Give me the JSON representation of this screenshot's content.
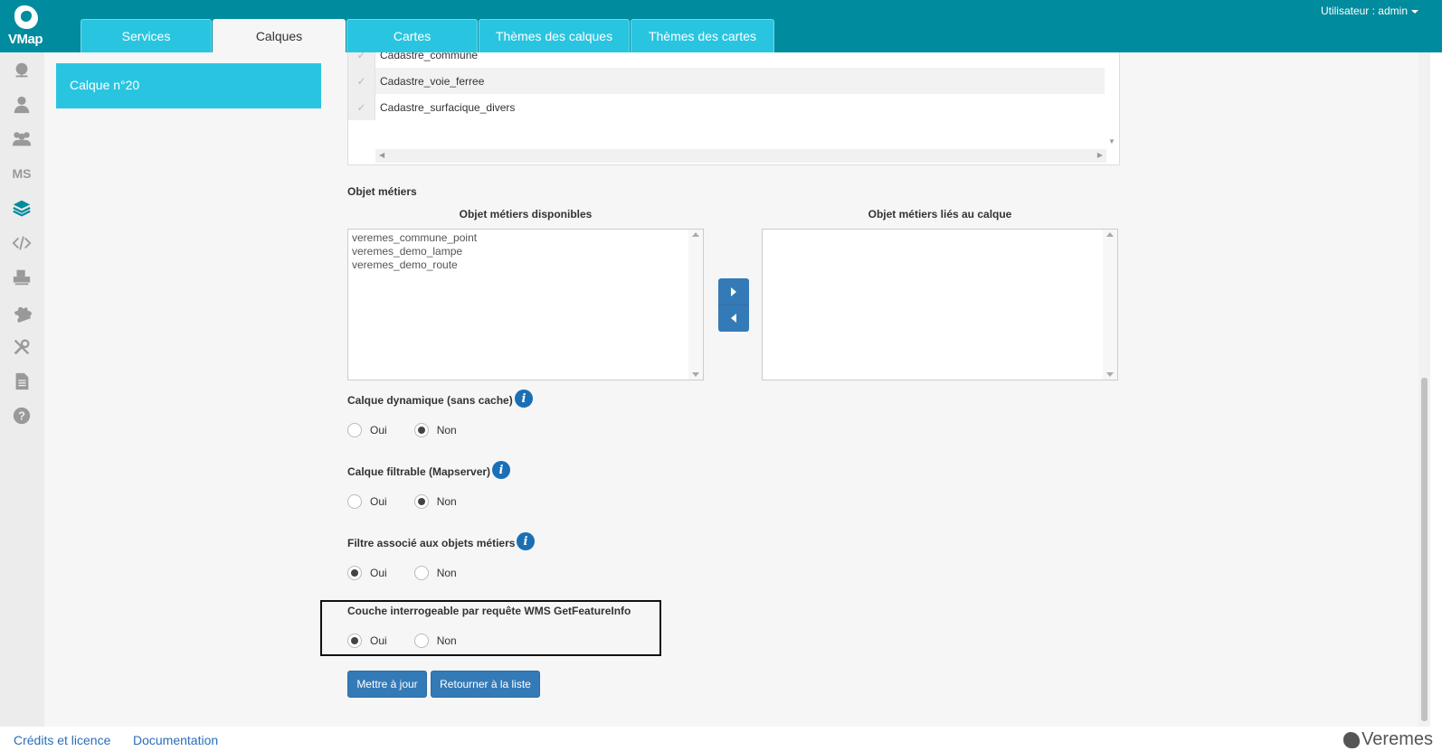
{
  "app": {
    "logo_text": "VMap"
  },
  "header": {
    "tabs": [
      {
        "label": "Services"
      },
      {
        "label": "Calques"
      },
      {
        "label": "Cartes"
      },
      {
        "label": "Thèmes des calques"
      },
      {
        "label": "Thèmes des cartes"
      }
    ],
    "active_tab": "Calques",
    "user_menu": "Utilisateur : admin"
  },
  "sidebar": {
    "icons": [
      "globe-icon",
      "user-icon",
      "users-icon",
      "ms-icon",
      "layers-icon",
      "code-icon",
      "print-icon",
      "puzzle-icon",
      "tools-icon",
      "document-icon",
      "help-icon"
    ],
    "ms_label": "MS",
    "active": "layers-icon"
  },
  "layer": {
    "title": "Calque n°20"
  },
  "layer_table": {
    "rows": [
      {
        "check": "✓",
        "name": "Cadastre_commune"
      },
      {
        "check": "✓",
        "name": "Cadastre_voie_ferree"
      },
      {
        "check": "✓",
        "name": "Cadastre_surfacique_divers"
      }
    ]
  },
  "business_objects": {
    "section_label": "Objet métiers",
    "available_header": "Objet métiers disponibles",
    "linked_header": "Objet métiers liés au calque",
    "available": [
      "veremes_commune_point",
      "veremes_demo_lampe",
      "veremes_demo_route"
    ],
    "linked": []
  },
  "options": [
    {
      "label": "Calque dynamique (sans cache)",
      "info": "i",
      "yes": "Oui",
      "no": "Non",
      "selected": "Non"
    },
    {
      "label": "Calque filtrable (Mapserver)",
      "info": "i",
      "yes": "Oui",
      "no": "Non",
      "selected": "Non"
    },
    {
      "label": "Filtre associé aux objets métiers",
      "info": "i",
      "yes": "Oui",
      "no": "Non",
      "selected": "Oui"
    },
    {
      "label": "Couche interrogeable par requête WMS GetFeatureInfo",
      "yes": "Oui",
      "no": "Non",
      "selected": "Oui"
    }
  ],
  "actions": {
    "update": "Mettre à jour",
    "back": "Retourner à la liste"
  },
  "footer": {
    "credits": "Crédits et licence",
    "documentation": "Documentation",
    "brand": "Veremes"
  },
  "colors": {
    "header": "#008b9e",
    "tab": "#29c5e0",
    "primary": "#337ab7",
    "info": "#1a6fb5"
  }
}
